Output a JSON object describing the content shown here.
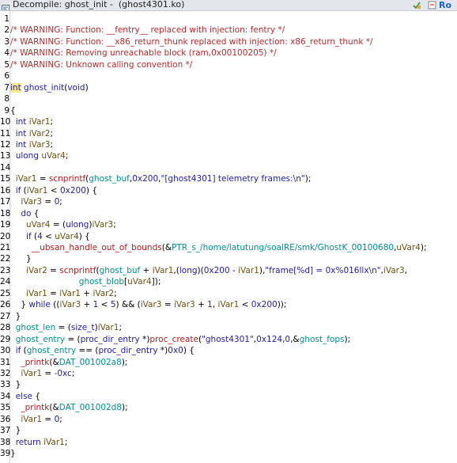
{
  "window": {
    "title": "Decompile: ghost_init -  (ghost4301.ko)",
    "mode_badge": "Ro",
    "icons": [
      "decompiler-icon",
      "snapshot-icon",
      "refresh-icon"
    ]
  },
  "colors": {
    "comment": "#b32b2b",
    "type": "#1a1aa6",
    "function": "#1d1da3",
    "local_var": "#6b5012",
    "global": "#008e8e",
    "string": "#1d1da3",
    "highlight": "#fbe98b"
  },
  "code": {
    "line_numbers": [
      "1",
      "2",
      "3",
      "4",
      "5",
      "6",
      "7",
      "8",
      "9",
      "10",
      "11",
      "12",
      "13",
      "14",
      "15",
      "16",
      "17",
      "18",
      "19",
      "20",
      "21",
      "22",
      "23",
      "24",
      "25",
      "26",
      "27",
      "28",
      "29",
      "30",
      "31",
      "32",
      "33",
      "34",
      "35",
      "36",
      "37",
      "38",
      "39"
    ],
    "lines": [
      [],
      [
        {
          "t": "/* WARNING: Function: __fentry__ replaced with injection: fentry */",
          "c": "comment"
        }
      ],
      [
        {
          "t": "/* WARNING: Function: __x86_return_thunk replaced with injection: x86_return_thunk */",
          "c": "comment"
        }
      ],
      [
        {
          "t": "/* WARNING: Removing unreachable block (ram,0x00100205) */",
          "c": "comment"
        }
      ],
      [
        {
          "t": "/* WARNING: Unknown calling convention */",
          "c": "comment"
        }
      ],
      [],
      [
        {
          "t": "int",
          "c": "type-hl"
        },
        {
          "t": " ",
          "c": "plain"
        },
        {
          "t": "ghost_init",
          "c": "func"
        },
        {
          "t": "(",
          "c": "plain"
        },
        {
          "t": "void",
          "c": "type"
        },
        {
          "t": ")",
          "c": "plain"
        }
      ],
      [],
      [
        {
          "t": "{",
          "c": "plain"
        }
      ],
      [
        {
          "t": "  ",
          "c": "plain"
        },
        {
          "t": "int",
          "c": "type"
        },
        {
          "t": " ",
          "c": "plain"
        },
        {
          "t": "iVar1",
          "c": "var"
        },
        {
          "t": ";",
          "c": "plain"
        }
      ],
      [
        {
          "t": "  ",
          "c": "plain"
        },
        {
          "t": "int",
          "c": "type"
        },
        {
          "t": " ",
          "c": "plain"
        },
        {
          "t": "iVar2",
          "c": "var"
        },
        {
          "t": ";",
          "c": "plain"
        }
      ],
      [
        {
          "t": "  ",
          "c": "plain"
        },
        {
          "t": "int",
          "c": "type"
        },
        {
          "t": " ",
          "c": "plain"
        },
        {
          "t": "iVar3",
          "c": "var"
        },
        {
          "t": ";",
          "c": "plain"
        }
      ],
      [
        {
          "t": "  ",
          "c": "plain"
        },
        {
          "t": "ulong",
          "c": "type"
        },
        {
          "t": " ",
          "c": "plain"
        },
        {
          "t": "uVar4",
          "c": "var"
        },
        {
          "t": ";",
          "c": "plain"
        }
      ],
      [],
      [
        {
          "t": "  ",
          "c": "plain"
        },
        {
          "t": "iVar1",
          "c": "var"
        },
        {
          "t": " = ",
          "c": "plain"
        },
        {
          "t": "scnprintf",
          "c": "callred"
        },
        {
          "t": "(",
          "c": "plain"
        },
        {
          "t": "ghost_buf",
          "c": "global"
        },
        {
          "t": ",",
          "c": "plain"
        },
        {
          "t": "0x200",
          "c": "num"
        },
        {
          "t": ",",
          "c": "plain"
        },
        {
          "t": "\"[ghost4301] telemetry frames:\\n\"",
          "c": "str"
        },
        {
          "t": ");",
          "c": "plain"
        }
      ],
      [
        {
          "t": "  ",
          "c": "plain"
        },
        {
          "t": "if",
          "c": "kw"
        },
        {
          "t": " (",
          "c": "plain"
        },
        {
          "t": "iVar1",
          "c": "var"
        },
        {
          "t": " < ",
          "c": "plain"
        },
        {
          "t": "0x200",
          "c": "num"
        },
        {
          "t": ") {",
          "c": "plain"
        }
      ],
      [
        {
          "t": "    ",
          "c": "plain"
        },
        {
          "t": "iVar3",
          "c": "var"
        },
        {
          "t": " = ",
          "c": "plain"
        },
        {
          "t": "0",
          "c": "num"
        },
        {
          "t": ";",
          "c": "plain"
        }
      ],
      [
        {
          "t": "    ",
          "c": "plain"
        },
        {
          "t": "do",
          "c": "kw"
        },
        {
          "t": " {",
          "c": "plain"
        }
      ],
      [
        {
          "t": "      ",
          "c": "plain"
        },
        {
          "t": "uVar4",
          "c": "var"
        },
        {
          "t": " = (",
          "c": "plain"
        },
        {
          "t": "ulong",
          "c": "type"
        },
        {
          "t": ")",
          "c": "plain"
        },
        {
          "t": "iVar3",
          "c": "var"
        },
        {
          "t": ";",
          "c": "plain"
        }
      ],
      [
        {
          "t": "      ",
          "c": "plain"
        },
        {
          "t": "if",
          "c": "kw"
        },
        {
          "t": " (",
          "c": "plain"
        },
        {
          "t": "4",
          "c": "num"
        },
        {
          "t": " < ",
          "c": "plain"
        },
        {
          "t": "uVar4",
          "c": "var"
        },
        {
          "t": ") {",
          "c": "plain"
        }
      ],
      [
        {
          "t": "        ",
          "c": "plain"
        },
        {
          "t": "__ubsan_handle_out_of_bounds",
          "c": "callred"
        },
        {
          "t": "(&",
          "c": "plain"
        },
        {
          "t": "PTR_s_/home/latutung/soalRE/smk/GhostK_00100680",
          "c": "global"
        },
        {
          "t": ",",
          "c": "plain"
        },
        {
          "t": "uVar4",
          "c": "var"
        },
        {
          "t": ");",
          "c": "plain"
        }
      ],
      [
        {
          "t": "      }",
          "c": "plain"
        }
      ],
      [
        {
          "t": "      ",
          "c": "plain"
        },
        {
          "t": "iVar2",
          "c": "var"
        },
        {
          "t": " = ",
          "c": "plain"
        },
        {
          "t": "scnprintf",
          "c": "callred"
        },
        {
          "t": "(",
          "c": "plain"
        },
        {
          "t": "ghost_buf",
          "c": "global"
        },
        {
          "t": " + ",
          "c": "plain"
        },
        {
          "t": "iVar1",
          "c": "var"
        },
        {
          "t": ",(",
          "c": "plain"
        },
        {
          "t": "long",
          "c": "type"
        },
        {
          "t": ")(",
          "c": "plain"
        },
        {
          "t": "0x200",
          "c": "num"
        },
        {
          "t": " - ",
          "c": "plain"
        },
        {
          "t": "iVar1",
          "c": "var"
        },
        {
          "t": "),",
          "c": "plain"
        },
        {
          "t": "\"frame[%d] = 0x%016llx\\n\"",
          "c": "str"
        },
        {
          "t": ",",
          "c": "plain"
        },
        {
          "t": "iVar3",
          "c": "var"
        },
        {
          "t": ",",
          "c": "plain"
        }
      ],
      [
        {
          "t": "                          ",
          "c": "plain"
        },
        {
          "t": "ghost_blob",
          "c": "global"
        },
        {
          "t": "[",
          "c": "plain"
        },
        {
          "t": "uVar4",
          "c": "var"
        },
        {
          "t": "]);",
          "c": "plain"
        }
      ],
      [
        {
          "t": "      ",
          "c": "plain"
        },
        {
          "t": "iVar1",
          "c": "var"
        },
        {
          "t": " = ",
          "c": "plain"
        },
        {
          "t": "iVar1",
          "c": "var"
        },
        {
          "t": " + ",
          "c": "plain"
        },
        {
          "t": "iVar2",
          "c": "var"
        },
        {
          "t": ";",
          "c": "plain"
        }
      ],
      [
        {
          "t": "    } ",
          "c": "plain"
        },
        {
          "t": "while",
          "c": "kw"
        },
        {
          "t": " ((",
          "c": "plain"
        },
        {
          "t": "iVar3",
          "c": "var"
        },
        {
          "t": " + ",
          "c": "plain"
        },
        {
          "t": "1",
          "c": "num"
        },
        {
          "t": " < ",
          "c": "plain"
        },
        {
          "t": "5",
          "c": "num"
        },
        {
          "t": ") && (",
          "c": "plain"
        },
        {
          "t": "iVar3",
          "c": "var"
        },
        {
          "t": " = ",
          "c": "plain"
        },
        {
          "t": "iVar3",
          "c": "var"
        },
        {
          "t": " + ",
          "c": "plain"
        },
        {
          "t": "1",
          "c": "num"
        },
        {
          "t": ", ",
          "c": "plain"
        },
        {
          "t": "iVar1",
          "c": "var"
        },
        {
          "t": " < ",
          "c": "plain"
        },
        {
          "t": "0x200",
          "c": "num"
        },
        {
          "t": "));",
          "c": "plain"
        }
      ],
      [
        {
          "t": "  }",
          "c": "plain"
        }
      ],
      [
        {
          "t": "  ",
          "c": "plain"
        },
        {
          "t": "ghost_len",
          "c": "global"
        },
        {
          "t": " = (",
          "c": "plain"
        },
        {
          "t": "size_t",
          "c": "type"
        },
        {
          "t": ")",
          "c": "plain"
        },
        {
          "t": "iVar1",
          "c": "var"
        },
        {
          "t": ";",
          "c": "plain"
        }
      ],
      [
        {
          "t": "  ",
          "c": "plain"
        },
        {
          "t": "ghost_entry",
          "c": "global"
        },
        {
          "t": " = (",
          "c": "plain"
        },
        {
          "t": "proc_dir_entry",
          "c": "type"
        },
        {
          "t": " *)",
          "c": "plain"
        },
        {
          "t": "proc_create",
          "c": "callred"
        },
        {
          "t": "(",
          "c": "plain"
        },
        {
          "t": "\"ghost4301\"",
          "c": "str"
        },
        {
          "t": ",",
          "c": "plain"
        },
        {
          "t": "0x124",
          "c": "num"
        },
        {
          "t": ",",
          "c": "plain"
        },
        {
          "t": "0",
          "c": "num"
        },
        {
          "t": ",&",
          "c": "plain"
        },
        {
          "t": "ghost_fops",
          "c": "global"
        },
        {
          "t": ");",
          "c": "plain"
        }
      ],
      [
        {
          "t": "  ",
          "c": "plain"
        },
        {
          "t": "if",
          "c": "kw"
        },
        {
          "t": " (",
          "c": "plain"
        },
        {
          "t": "ghost_entry",
          "c": "global"
        },
        {
          "t": " == (",
          "c": "plain"
        },
        {
          "t": "proc_dir_entry",
          "c": "type"
        },
        {
          "t": " *)",
          "c": "plain"
        },
        {
          "t": "0x0",
          "c": "num"
        },
        {
          "t": ") {",
          "c": "plain"
        }
      ],
      [
        {
          "t": "    ",
          "c": "plain"
        },
        {
          "t": "_printk",
          "c": "callred"
        },
        {
          "t": "(&",
          "c": "plain"
        },
        {
          "t": "DAT_001002a8",
          "c": "global"
        },
        {
          "t": ");",
          "c": "plain"
        }
      ],
      [
        {
          "t": "    ",
          "c": "plain"
        },
        {
          "t": "iVar1",
          "c": "var"
        },
        {
          "t": " = ",
          "c": "plain"
        },
        {
          "t": "-0xc",
          "c": "num"
        },
        {
          "t": ";",
          "c": "plain"
        }
      ],
      [
        {
          "t": "  }",
          "c": "plain"
        }
      ],
      [
        {
          "t": "  ",
          "c": "plain"
        },
        {
          "t": "else",
          "c": "kw"
        },
        {
          "t": " {",
          "c": "plain"
        }
      ],
      [
        {
          "t": "    ",
          "c": "plain"
        },
        {
          "t": "_printk",
          "c": "callred"
        },
        {
          "t": "(&",
          "c": "plain"
        },
        {
          "t": "DAT_001002d8",
          "c": "global"
        },
        {
          "t": ");",
          "c": "plain"
        }
      ],
      [
        {
          "t": "    ",
          "c": "plain"
        },
        {
          "t": "iVar1",
          "c": "var"
        },
        {
          "t": " = ",
          "c": "plain"
        },
        {
          "t": "0",
          "c": "num"
        },
        {
          "t": ";",
          "c": "plain"
        }
      ],
      [
        {
          "t": "  }",
          "c": "plain"
        }
      ],
      [
        {
          "t": "  ",
          "c": "plain"
        },
        {
          "t": "return",
          "c": "kw"
        },
        {
          "t": " ",
          "c": "plain"
        },
        {
          "t": "iVar1",
          "c": "var"
        },
        {
          "t": ";",
          "c": "plain"
        }
      ],
      [
        {
          "t": "}",
          "c": "plain"
        }
      ]
    ]
  }
}
